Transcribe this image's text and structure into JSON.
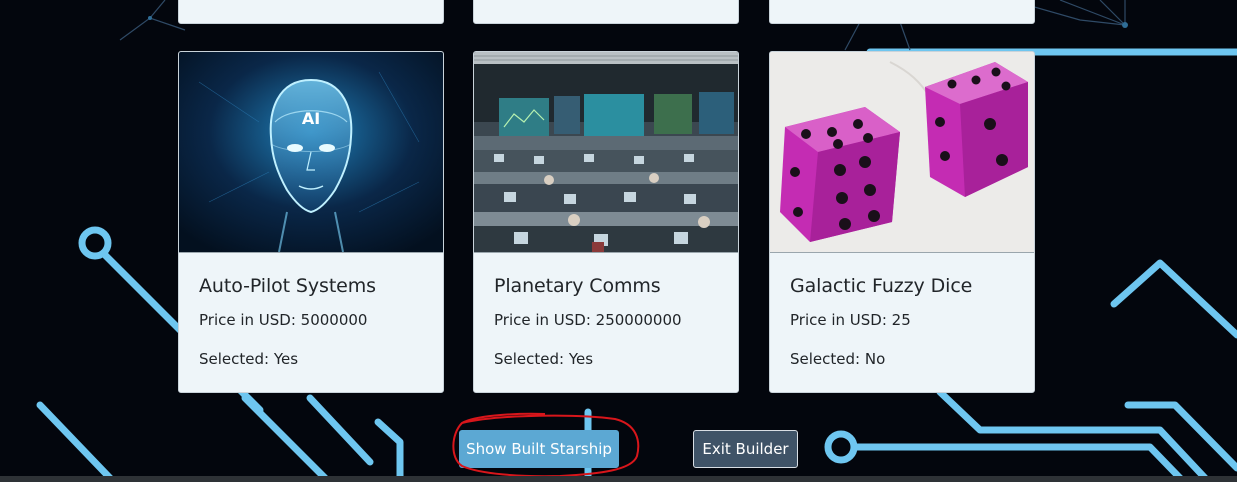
{
  "colors": {
    "page_bg": "#03060d",
    "circuit": "#6ec6f0",
    "card_bg": "#eef5f9",
    "primary_button": "#5ca8d3",
    "secondary_button": "#3f5367",
    "annotation": "#d8161b"
  },
  "cards": [
    {
      "title": "Auto-Pilot Systems",
      "price": "Price in USD: 5000000",
      "selected": "Selected: Yes",
      "image": "ai-head-image"
    },
    {
      "title": "Planetary Comms",
      "price": "Price in USD: 250000000",
      "selected": "Selected: Yes",
      "image": "mission-control-image"
    },
    {
      "title": "Galactic Fuzzy Dice",
      "price": "Price in USD: 25",
      "selected": "Selected: No",
      "image": "fuzzy-dice-image"
    }
  ],
  "actions": {
    "show_label": "Show Built Starship",
    "exit_label": "Exit Builder"
  }
}
